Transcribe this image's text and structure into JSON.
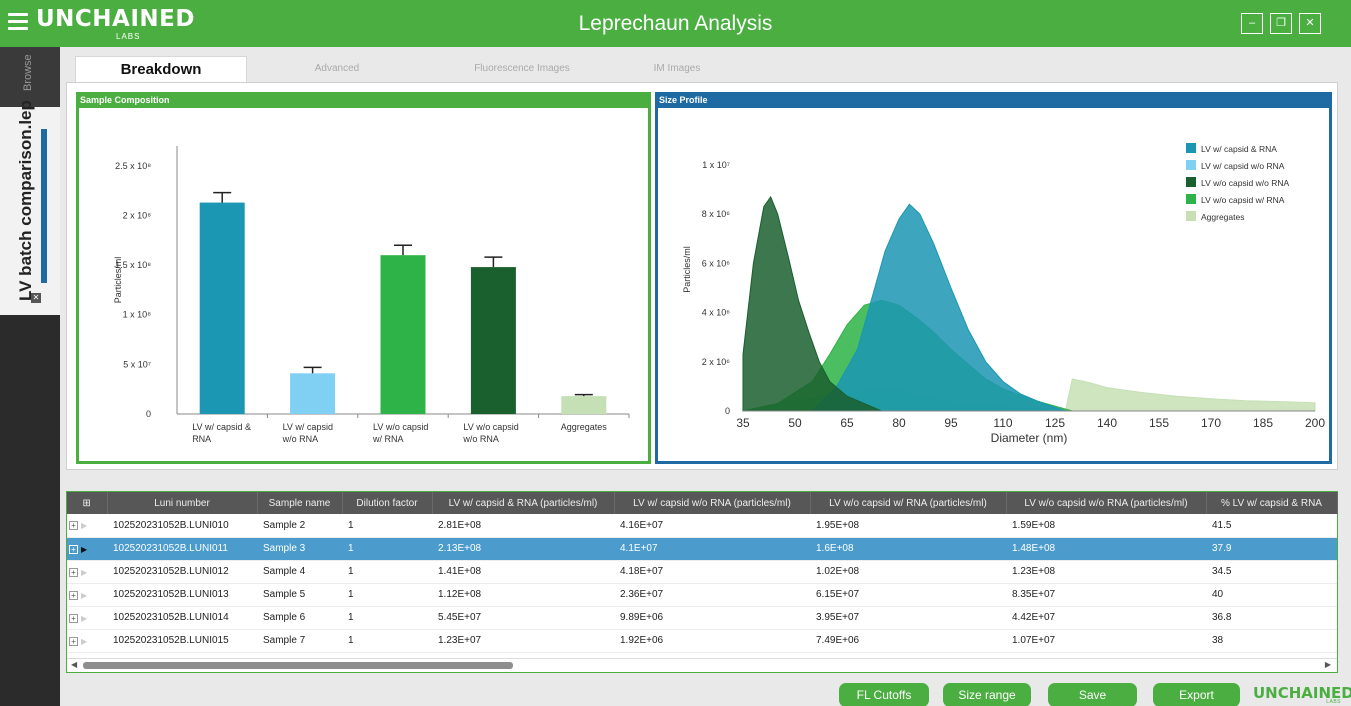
{
  "window": {
    "brand": "UNCHAINED",
    "brand_sub": "LABS",
    "title": "Leprechaun Analysis",
    "minimize": "–",
    "restore": "❐",
    "close": "✕"
  },
  "sidebar": {
    "browse_label": "Browse",
    "file_label": "LV batch comparison.lep",
    "file_close": "✕"
  },
  "tabs": [
    {
      "label": "Breakdown",
      "active": true
    },
    {
      "label": "Advanced",
      "active": false
    },
    {
      "label": "Fluorescence Images",
      "active": false
    },
    {
      "label": "IM Images",
      "active": false
    }
  ],
  "panels": {
    "composition_title": "Sample Composition",
    "size_title": "Size Profile"
  },
  "chart_data": [
    {
      "type": "bar",
      "ylabel": "Particles/ml",
      "ylim": [
        0,
        270000000
      ],
      "y_ticks": [
        {
          "value": 0,
          "label": "0"
        },
        {
          "value": 50000000,
          "label": "5 x 10⁷"
        },
        {
          "value": 100000000,
          "label": "1 x 10⁸"
        },
        {
          "value": 150000000,
          "label": "1.5 x 10⁸"
        },
        {
          "value": 200000000,
          "label": "2 x 10⁸"
        },
        {
          "value": 250000000,
          "label": "2.5 x 10⁸"
        }
      ],
      "categories": [
        [
          "LV w/ capsid &",
          "RNA"
        ],
        [
          "LV w/ capsid",
          "w/o RNA"
        ],
        [
          "LV w/o capsid",
          "w/ RNA"
        ],
        [
          "LV w/o capsid",
          "w/o RNA"
        ],
        [
          "Aggregates"
        ]
      ],
      "values": [
        213000000,
        41000000,
        160000000,
        148000000,
        18000000
      ],
      "errors": [
        10000000,
        6000000,
        10000000,
        10000000,
        1500000
      ],
      "colors": [
        "#1b96b3",
        "#7fd0f2",
        "#2db347",
        "#1a5f2e",
        "#c5e0b4"
      ]
    },
    {
      "type": "area",
      "xlabel": "Diameter (nm)",
      "ylabel": "Particles/ml",
      "xlim": [
        35,
        200
      ],
      "ylim": [
        0,
        11500000
      ],
      "x_ticks": [
        35,
        50,
        65,
        80,
        95,
        110,
        125,
        140,
        155,
        170,
        185,
        200
      ],
      "y_ticks": [
        {
          "value": 0,
          "label": "0"
        },
        {
          "value": 2000000,
          "label": "2 x 10⁶"
        },
        {
          "value": 4000000,
          "label": "4 x 10⁶"
        },
        {
          "value": 6000000,
          "label": "6 x 10⁶"
        },
        {
          "value": 8000000,
          "label": "8 x 10⁶"
        },
        {
          "value": 10000000,
          "label": "1 x 10⁷"
        }
      ],
      "legend_position": "top-right",
      "series": [
        {
          "name": "LV w/ capsid & RNA",
          "color": "#1b96b3",
          "x": [
            55,
            62,
            68,
            72,
            76,
            80,
            83,
            86,
            90,
            95,
            100,
            105,
            110,
            115,
            120,
            128
          ],
          "y": [
            0,
            1000000,
            2500000,
            4500000,
            6500000,
            7800000,
            8400000,
            8000000,
            6800000,
            5000000,
            3300000,
            2000000,
            1200000,
            700000,
            400000,
            0
          ]
        },
        {
          "name": "LV w/ capsid w/o RNA",
          "color": "#7fd0f2",
          "x": [
            35,
            40,
            45,
            50,
            55,
            60,
            65,
            70,
            75,
            80,
            85,
            90,
            95,
            100,
            110,
            120,
            130
          ],
          "y": [
            0,
            150000,
            300000,
            400000,
            500000,
            600000,
            700000,
            800000,
            850000,
            800000,
            650000,
            500000,
            350000,
            250000,
            150000,
            80000,
            0
          ]
        },
        {
          "name": "LV w/o capsid w/o RNA",
          "color": "#1a5f2e",
          "x": [
            35,
            38,
            41,
            43,
            45,
            48,
            51,
            54,
            57,
            60,
            65,
            70,
            75
          ],
          "y": [
            2300000,
            6000000,
            8300000,
            8700000,
            8000000,
            6300000,
            4500000,
            3200000,
            2000000,
            1200000,
            600000,
            300000,
            0
          ]
        },
        {
          "name": "LV w/o capsid w/ RNA",
          "color": "#2db347",
          "x": [
            35,
            45,
            55,
            60,
            65,
            70,
            75,
            80,
            85,
            90,
            95,
            100,
            105,
            110,
            120,
            130
          ],
          "y": [
            0,
            300000,
            1200000,
            2300000,
            3500000,
            4300000,
            4500000,
            4300000,
            3800000,
            3200000,
            2500000,
            1900000,
            1300000,
            900000,
            400000,
            0
          ]
        },
        {
          "name": "Aggregates",
          "color": "#c5e0b4",
          "x": [
            128,
            130,
            135,
            140,
            150,
            160,
            170,
            180,
            190,
            200
          ],
          "y": [
            0,
            1300000,
            1150000,
            950000,
            750000,
            600000,
            500000,
            420000,
            380000,
            330000
          ]
        }
      ]
    }
  ],
  "table": {
    "columns": [
      "",
      "Luni number",
      "Sample name",
      "Dilution factor",
      "LV w/ capsid & RNA (particles/ml)",
      "LV w/ capsid w/o RNA (particles/ml)",
      "LV w/o capsid w/ RNA (particles/ml)",
      "LV w/o capsid w/o RNA (particles/ml)",
      "% LV w/ capsid & RNA"
    ],
    "rows": [
      {
        "luni": "102520231052B.LUNI010",
        "sample": "Sample 2",
        "dilution": "1",
        "c1": "2.81E+08",
        "c2": "4.16E+07",
        "c3": "1.95E+08",
        "c4": "1.59E+08",
        "pct": "41.5",
        "selected": false
      },
      {
        "luni": "102520231052B.LUNI011",
        "sample": "Sample 3",
        "dilution": "1",
        "c1": "2.13E+08",
        "c2": "4.1E+07",
        "c3": "1.6E+08",
        "c4": "1.48E+08",
        "pct": "37.9",
        "selected": true
      },
      {
        "luni": "102520231052B.LUNI012",
        "sample": "Sample 4",
        "dilution": "1",
        "c1": "1.41E+08",
        "c2": "4.18E+07",
        "c3": "1.02E+08",
        "c4": "1.23E+08",
        "pct": "34.5",
        "selected": false
      },
      {
        "luni": "102520231052B.LUNI013",
        "sample": "Sample 5",
        "dilution": "1",
        "c1": "1.12E+08",
        "c2": "2.36E+07",
        "c3": "6.15E+07",
        "c4": "8.35E+07",
        "pct": "40",
        "selected": false
      },
      {
        "luni": "102520231052B.LUNI014",
        "sample": "Sample 6",
        "dilution": "1",
        "c1": "5.45E+07",
        "c2": "9.89E+06",
        "c3": "3.95E+07",
        "c4": "4.42E+07",
        "pct": "36.8",
        "selected": false
      },
      {
        "luni": "102520231052B.LUNI015",
        "sample": "Sample 7",
        "dilution": "1",
        "c1": "1.23E+07",
        "c2": "1.92E+06",
        "c3": "7.49E+06",
        "c4": "1.07E+07",
        "pct": "38",
        "selected": false
      }
    ]
  },
  "buttons": {
    "fl_cutoffs": "FL Cutoffs",
    "size_range": "Size range",
    "save": "Save",
    "export": "Export"
  },
  "footer": {
    "logo": "UNCHAINED",
    "logo_sub": "LABS"
  },
  "colors": {
    "brand_green": "#4bae41",
    "size_blue": "#1e6aa3",
    "selected_row": "#4b9ccd"
  }
}
